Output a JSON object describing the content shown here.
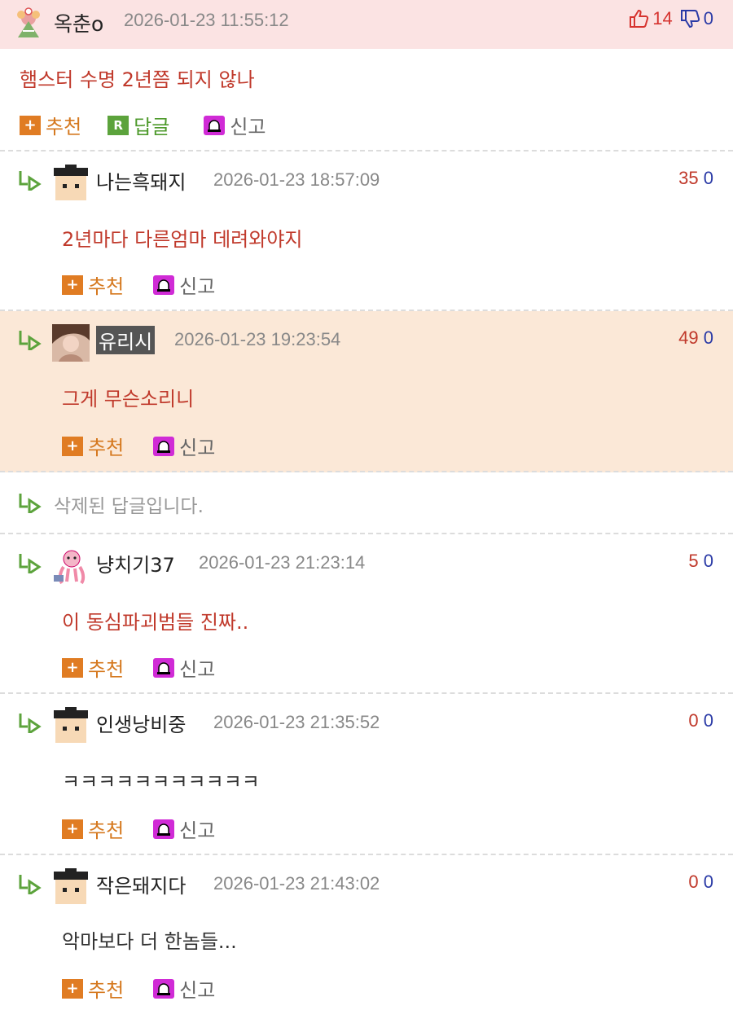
{
  "top": {
    "nickname": "옥춘o",
    "timestamp": "2026-01-23 11:55:12",
    "upvotes": "14",
    "downvotes": "0",
    "comment": "햄스터 수명 2년쯤 되지 않나"
  },
  "actions": {
    "recommend": "추천",
    "reply": "답글",
    "report": "신고",
    "reply_icon_letter": "R"
  },
  "replies": [
    {
      "nickname": "나는흑돼지",
      "timestamp": "2026-01-23 18:57:09",
      "up": "35",
      "down": "0",
      "text": "2년마다 다른엄마 데려와야지"
    },
    {
      "nickname": "유리시",
      "timestamp": "2026-01-23 19:23:54",
      "up": "49",
      "down": "0",
      "text": "그게 무슨소리니"
    },
    {
      "nickname": "냥치기37",
      "timestamp": "2026-01-23 21:23:14",
      "up": "5",
      "down": "0",
      "text": "이 동심파괴범들 진짜.."
    },
    {
      "nickname": "인생낭비중",
      "timestamp": "2026-01-23 21:35:52",
      "up": "0",
      "down": "0",
      "text": "ㅋㅋㅋㅋㅋㅋㅋㅋㅋㅋㅋ"
    },
    {
      "nickname": "작은돼지다",
      "timestamp": "2026-01-23 21:43:02",
      "up": "0",
      "down": "0",
      "text": "악마보다 더 한놈들..."
    }
  ],
  "deleted_message": "삭제된 답글입니다.",
  "colors": {
    "header_bg": "#fbe3e3",
    "highlight_bg": "#fbe8d7",
    "comment_text": "#c0392b",
    "up": "#c0392b",
    "down": "#2a3aa6"
  }
}
